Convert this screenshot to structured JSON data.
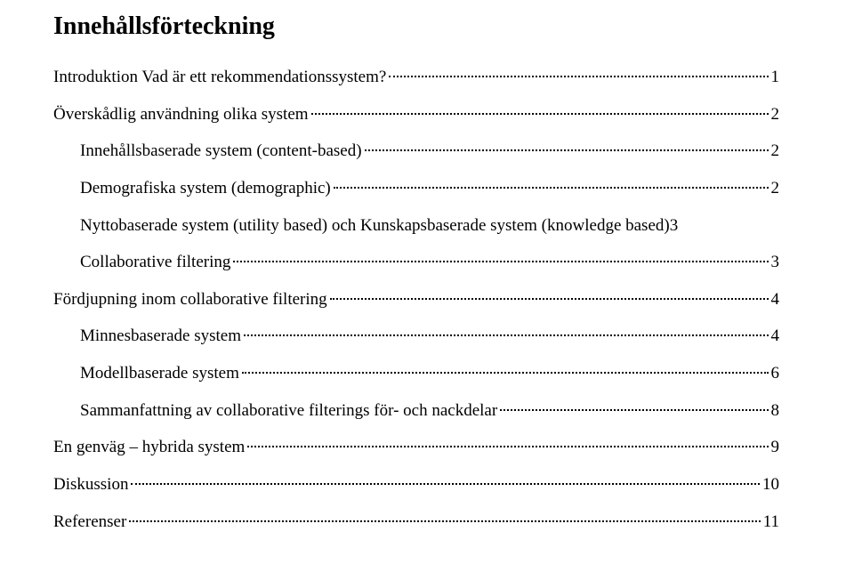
{
  "title": "Innehållsförteckning",
  "entries": [
    {
      "label": "Introduktion Vad är ett rekommendationssystem?",
      "page": "1",
      "indent": false,
      "special": false
    },
    {
      "label": "Överskådlig användning olika system",
      "page": "2",
      "indent": false,
      "special": false
    },
    {
      "label": "Innehållsbaserade system (content-based)",
      "page": "2",
      "indent": true,
      "special": false
    },
    {
      "label": "Demografiska system (demographic)",
      "page": "2",
      "indent": true,
      "special": false
    },
    {
      "label": "Nyttobaserade system (utility based) och Kunskapsbaserade system (knowledge based)",
      "page": "3",
      "indent": true,
      "special": true
    },
    {
      "label": "Collaborative filtering",
      "page": "3",
      "indent": true,
      "special": false
    },
    {
      "label": "Fördjupning inom collaborative filtering",
      "page": "4",
      "indent": false,
      "special": false
    },
    {
      "label": "Minnesbaserade system",
      "page": "4",
      "indent": true,
      "special": false
    },
    {
      "label": "Modellbaserade system",
      "page": "6",
      "indent": true,
      "special": false
    },
    {
      "label": "Sammanfattning av collaborative filterings för- och nackdelar",
      "page": "8",
      "indent": true,
      "special": false
    },
    {
      "label": "En genväg – hybrida system",
      "page": "9",
      "indent": false,
      "special": false
    },
    {
      "label": "Diskussion",
      "page": "10",
      "indent": false,
      "special": false
    },
    {
      "label": "Referenser",
      "page": "11",
      "indent": false,
      "special": false
    }
  ]
}
